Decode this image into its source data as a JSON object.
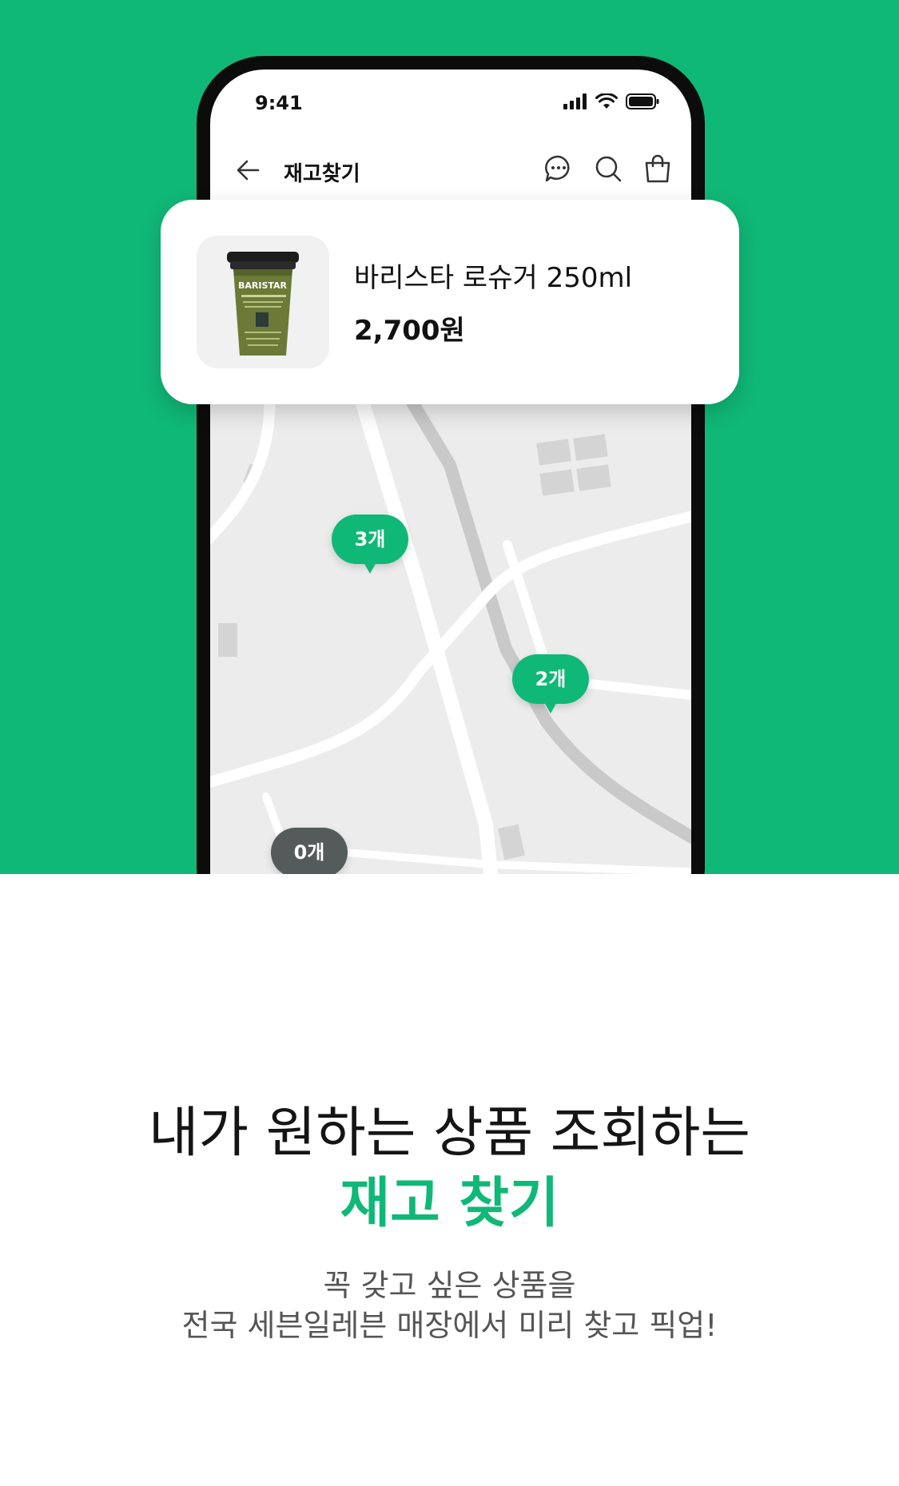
{
  "status_bar": {
    "time": "9:41"
  },
  "nav": {
    "title": "재고찾기"
  },
  "product": {
    "name": "바리스타 로슈거 250ml",
    "price": "2,700원",
    "package_label": "BARISTAR"
  },
  "map_pins": [
    {
      "label": "3개",
      "status": "in-stock"
    },
    {
      "label": "2개",
      "status": "in-stock"
    },
    {
      "label": "0개",
      "status": "out-of-stock"
    }
  ],
  "headline": {
    "line1": "내가 원하는 상품 조회하는",
    "line2": "재고 찾기"
  },
  "subtext": {
    "line1": "꼭 갖고 싶은 상품을",
    "line2": "전국 세븐일레븐 매장에서 미리 찾고 픽업!"
  },
  "colors": {
    "brand_green": "#10b877",
    "map_bg": "#ececec",
    "out_of_stock": "#555a5a"
  }
}
